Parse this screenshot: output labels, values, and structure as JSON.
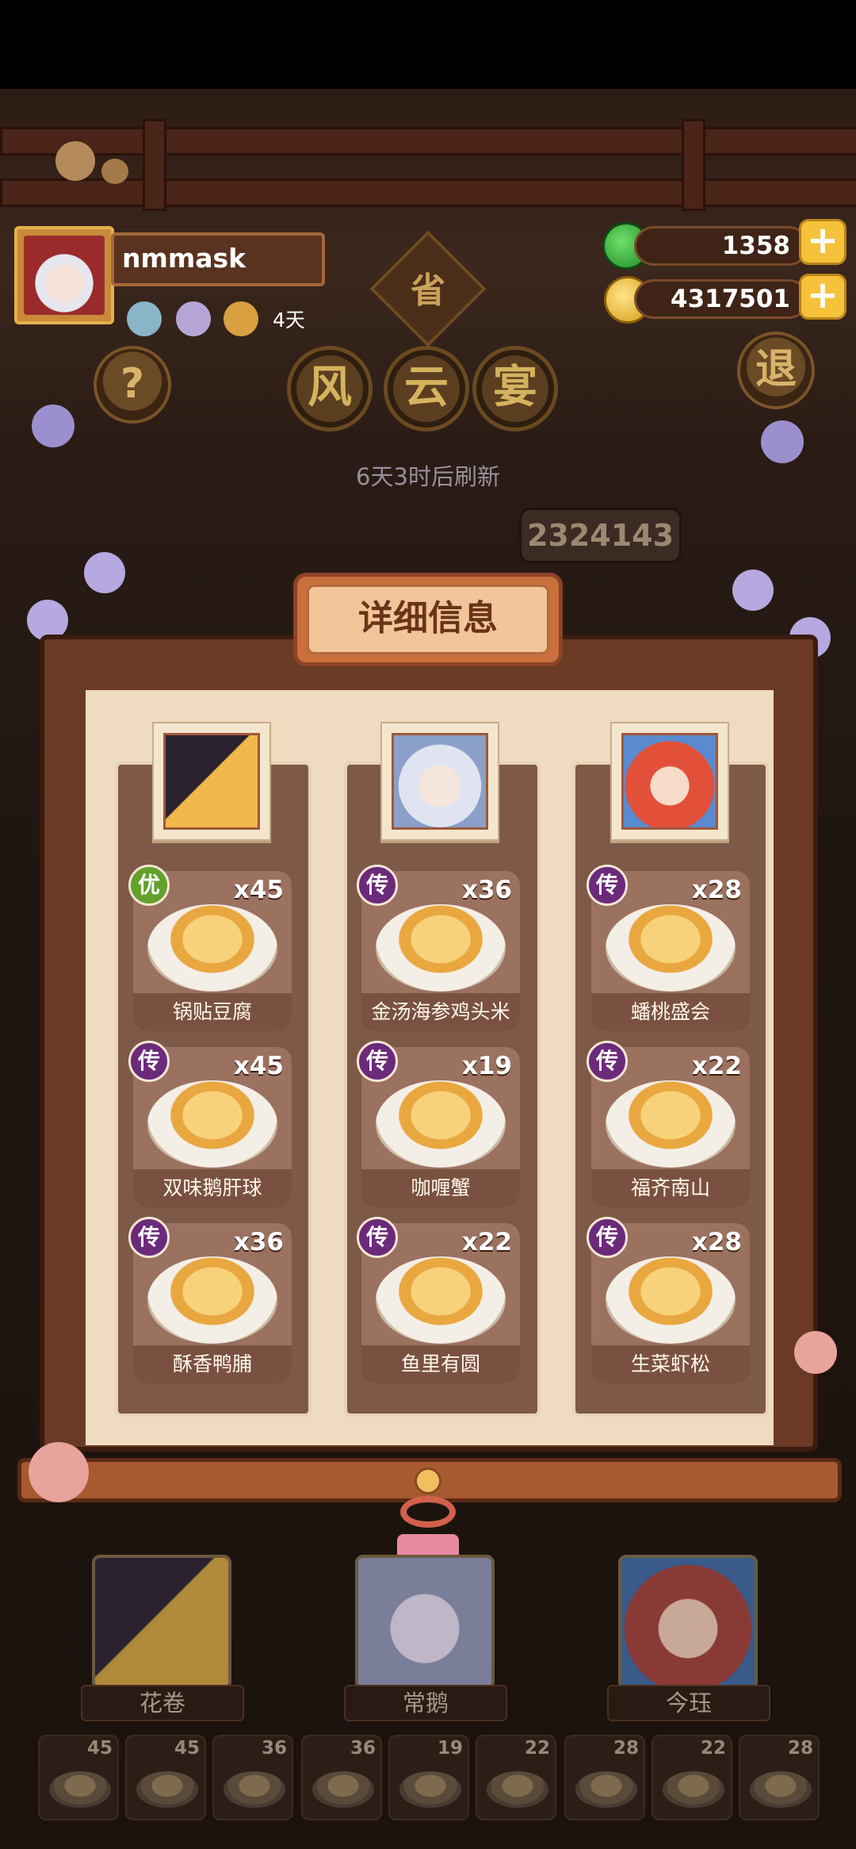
{
  "player": {
    "name": "nmmask",
    "days_label": "4天"
  },
  "resources": {
    "jade": "1358",
    "coins": "4317501"
  },
  "event": {
    "title_chars": [
      "风",
      "云",
      "宴"
    ],
    "region_char": "省",
    "refresh_text": "6天3时后刷新",
    "score": "2324143",
    "help_char": "?",
    "exit_char": "退"
  },
  "panel": {
    "title": "详细信息",
    "columns": [
      {
        "dishes": [
          {
            "name": "锅贴豆腐",
            "count": "x45",
            "badge": "优",
            "badge_type": "good"
          },
          {
            "name": "双味鹅肝球",
            "count": "x45",
            "badge": "传",
            "badge_type": "legend"
          },
          {
            "name": "酥香鸭脯",
            "count": "x36",
            "badge": "传",
            "badge_type": "legend"
          }
        ]
      },
      {
        "dishes": [
          {
            "name": "金汤海参鸡头米",
            "count": "x36",
            "badge": "传",
            "badge_type": "legend"
          },
          {
            "name": "咖喱蟹",
            "count": "x19",
            "badge": "传",
            "badge_type": "legend"
          },
          {
            "name": "鱼里有圆",
            "count": "x22",
            "badge": "传",
            "badge_type": "legend"
          }
        ]
      },
      {
        "dishes": [
          {
            "name": "蟠桃盛会",
            "count": "x28",
            "badge": "传",
            "badge_type": "legend"
          },
          {
            "name": "福齐南山",
            "count": "x22",
            "badge": "传",
            "badge_type": "legend"
          },
          {
            "name": "生菜虾松",
            "count": "x28",
            "badge": "传",
            "badge_type": "legend"
          }
        ]
      }
    ]
  },
  "characters": [
    {
      "name": "花卷"
    },
    {
      "name": "常鹅"
    },
    {
      "name": "今珏"
    }
  ],
  "dish_strip": [
    "45",
    "45",
    "36",
    "36",
    "19",
    "22",
    "28",
    "22",
    "28"
  ],
  "colors": {
    "panel_bg": "#eedbc0",
    "legend_badge": "#6b2a7a",
    "good_badge": "#63a12c",
    "accent_gold": "#f6c23b"
  }
}
